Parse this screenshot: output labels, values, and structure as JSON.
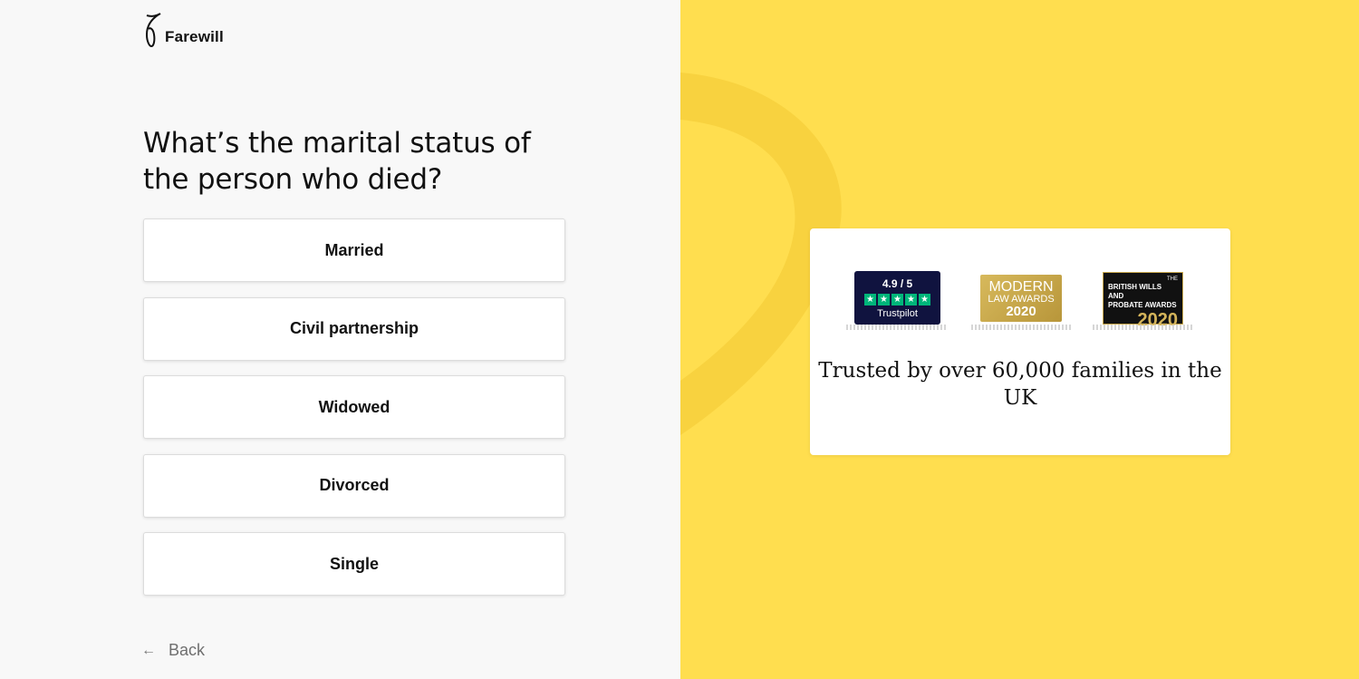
{
  "brand": {
    "name": "Farewill"
  },
  "question": {
    "title": "What’s the marital status of the person who died?"
  },
  "options": [
    {
      "label": "Married"
    },
    {
      "label": "Civil partnership"
    },
    {
      "label": "Widowed"
    },
    {
      "label": "Divorced"
    },
    {
      "label": "Single"
    }
  ],
  "back": {
    "label": "Back",
    "icon": "arrow-left-icon"
  },
  "trust": {
    "text": "Trusted by over 60,000 families in the UK",
    "badges": {
      "trustpilot": {
        "score": "4.9 / 5",
        "label": "Trustpilot",
        "star_color": "#00b67a"
      },
      "modern": {
        "line1": "MODERN",
        "line2": "LAW AWARDS",
        "year": "2020"
      },
      "british": {
        "the": "THE",
        "line1": "BRITISH WILLS AND",
        "line2": "PROBATE AWARDS",
        "year": "2020"
      }
    }
  },
  "colors": {
    "accent": "#ffde4f",
    "text": "#111111",
    "background": "#f8f8f8"
  }
}
